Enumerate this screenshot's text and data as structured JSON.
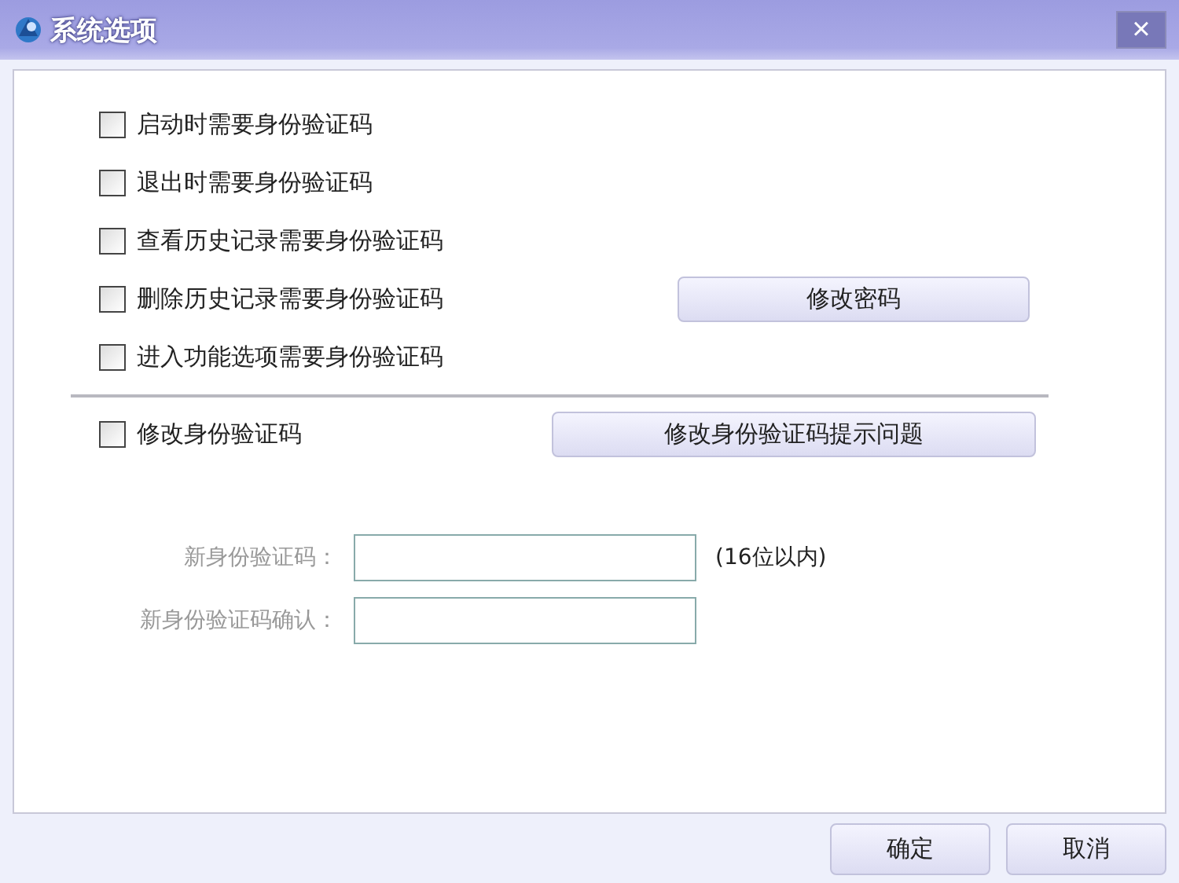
{
  "window": {
    "title": "系统选项",
    "close": "×"
  },
  "options": [
    {
      "label": "启动时需要身份验证码",
      "checked": false
    },
    {
      "label": "退出时需要身份验证码",
      "checked": false
    },
    {
      "label": "查看历史记录需要身份验证码",
      "checked": false
    },
    {
      "label": "删除历史记录需要身份验证码",
      "checked": false
    },
    {
      "label": "进入功能选项需要身份验证码",
      "checked": false
    }
  ],
  "change_password_button": "修改密码",
  "change_code": {
    "label": "修改身份验证码",
    "checked": false
  },
  "hint_question_button": "修改身份验证码提示问题",
  "code_fields": {
    "disabled": true,
    "fields": [
      {
        "label": "新身份验证码：",
        "note": "(16位以内)"
      },
      {
        "label": "新身份验证码确认："
      }
    ]
  },
  "buttons": [
    "确定",
    "取消"
  ]
}
